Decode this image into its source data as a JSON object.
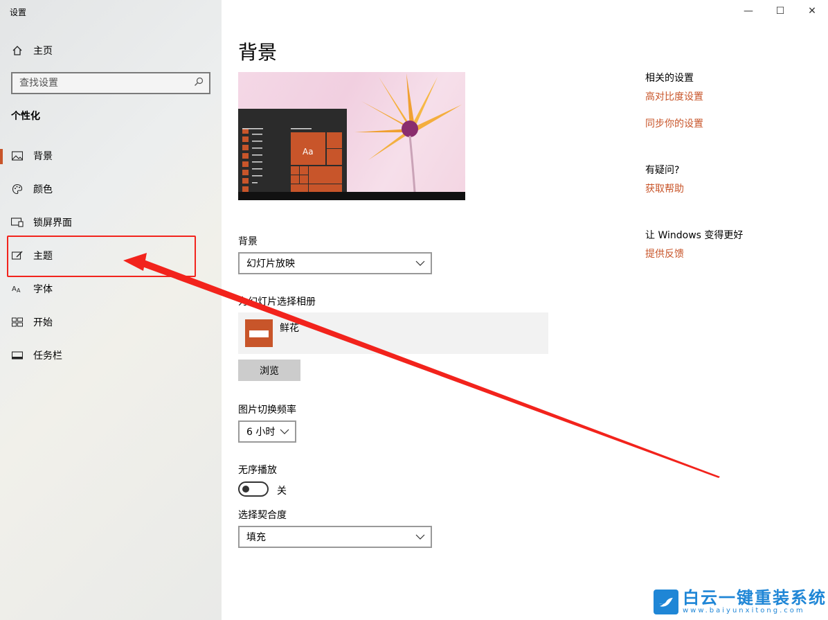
{
  "window": {
    "title": "设置",
    "minimize": "—",
    "maximize": "☐",
    "close": "✕"
  },
  "sidebar": {
    "home_label": "主页",
    "search_placeholder": "查找设置",
    "section": "个性化",
    "items": [
      {
        "label": "背景",
        "icon": "picture-icon",
        "active": true
      },
      {
        "label": "颜色",
        "icon": "palette-icon"
      },
      {
        "label": "锁屏界面",
        "icon": "lockscreen-icon"
      },
      {
        "label": "主题",
        "icon": "theme-brush-icon"
      },
      {
        "label": "字体",
        "icon": "font-icon"
      },
      {
        "label": "开始",
        "icon": "start-tiles-icon"
      },
      {
        "label": "任务栏",
        "icon": "taskbar-icon"
      }
    ]
  },
  "main": {
    "title": "背景",
    "preview_tile_text": "Aa",
    "background_label": "背景",
    "background_value": "幻灯片放映",
    "album_label": "为幻灯片选择相册",
    "album_name": "鲜花",
    "browse_label": "浏览",
    "interval_label": "图片切换频率",
    "interval_value": "6 小时",
    "shuffle_label": "无序播放",
    "shuffle_state": "关",
    "fit_label": "选择契合度",
    "fit_value": "填充"
  },
  "related": {
    "head": "相关的设置",
    "link1": "高对比度设置",
    "link2": "同步你的设置",
    "question_head": "有疑问?",
    "help_link": "获取帮助",
    "improve_head": "让 Windows 变得更好",
    "feedback_link": "提供反馈"
  },
  "watermark": {
    "main": "白云一键重装系统",
    "sub": "www.baiyunxitong.com"
  },
  "colors": {
    "accent": "#c8552a",
    "annotation": "#f2231c",
    "brand": "#1f86d6"
  }
}
